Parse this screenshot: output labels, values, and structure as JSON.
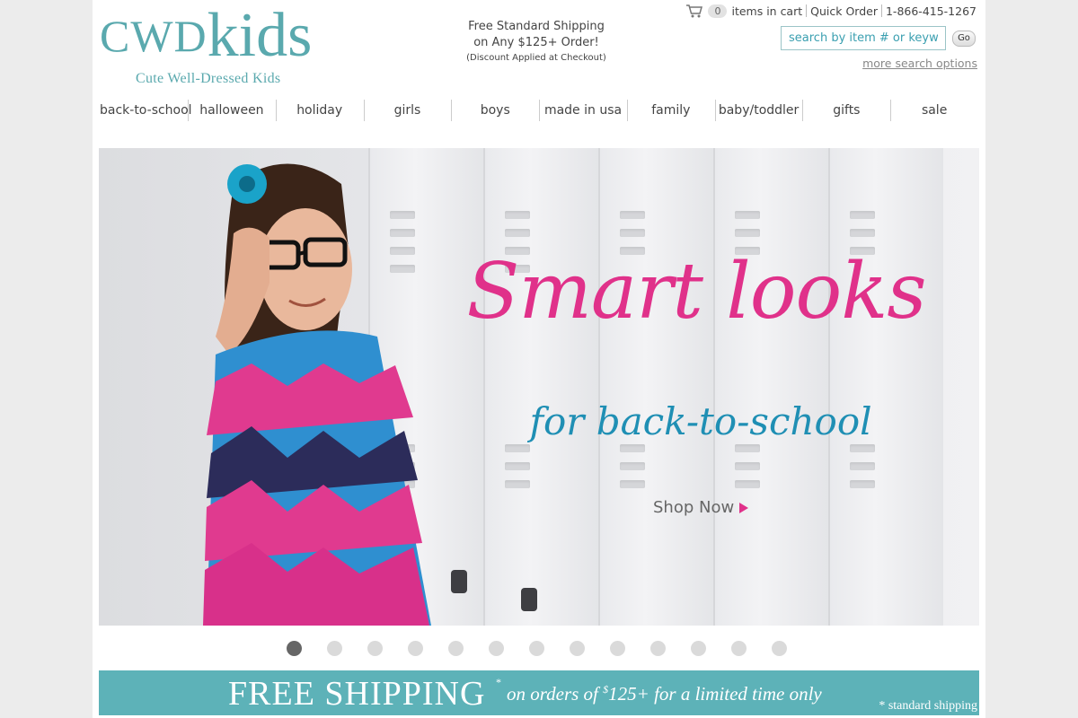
{
  "logo": {
    "brand_prefix": "CWD",
    "brand_suffix": "kids",
    "tagline": "Cute Well-Dressed Kids"
  },
  "promo": {
    "line1": "Free Standard Shipping",
    "line2": "on Any $125+ Order!",
    "line3": "(Discount Applied at Checkout)"
  },
  "utility": {
    "cart_count": "0",
    "cart_label": "items in cart",
    "quick_order": "Quick Order",
    "phone": "1-866-415-1267"
  },
  "search": {
    "placeholder": "search by item # or keyword",
    "go_label": "Go",
    "more_options": "more search options"
  },
  "nav": {
    "items": [
      "back-to-school",
      "halloween",
      "holiday",
      "girls",
      "boys",
      "made in usa",
      "family",
      "baby/toddler",
      "gifts",
      "sale"
    ]
  },
  "hero": {
    "headline": "Smart looks",
    "subhead": "for back-to-school",
    "cta": "Shop Now",
    "slide_count": 13,
    "active_slide": 1
  },
  "shipping_banner": {
    "big": "FREE SHIPPING",
    "star": "*",
    "small_prefix": "on orders of ",
    "small_sup": "$",
    "small_suffix": "125+ for a limited time only",
    "note": "* standard shipping"
  },
  "colors": {
    "brand_teal": "#5aa9ae",
    "headline_pink": "#e0318a",
    "subhead_blue": "#1f8fb4",
    "banner_teal": "#5db2b8"
  }
}
